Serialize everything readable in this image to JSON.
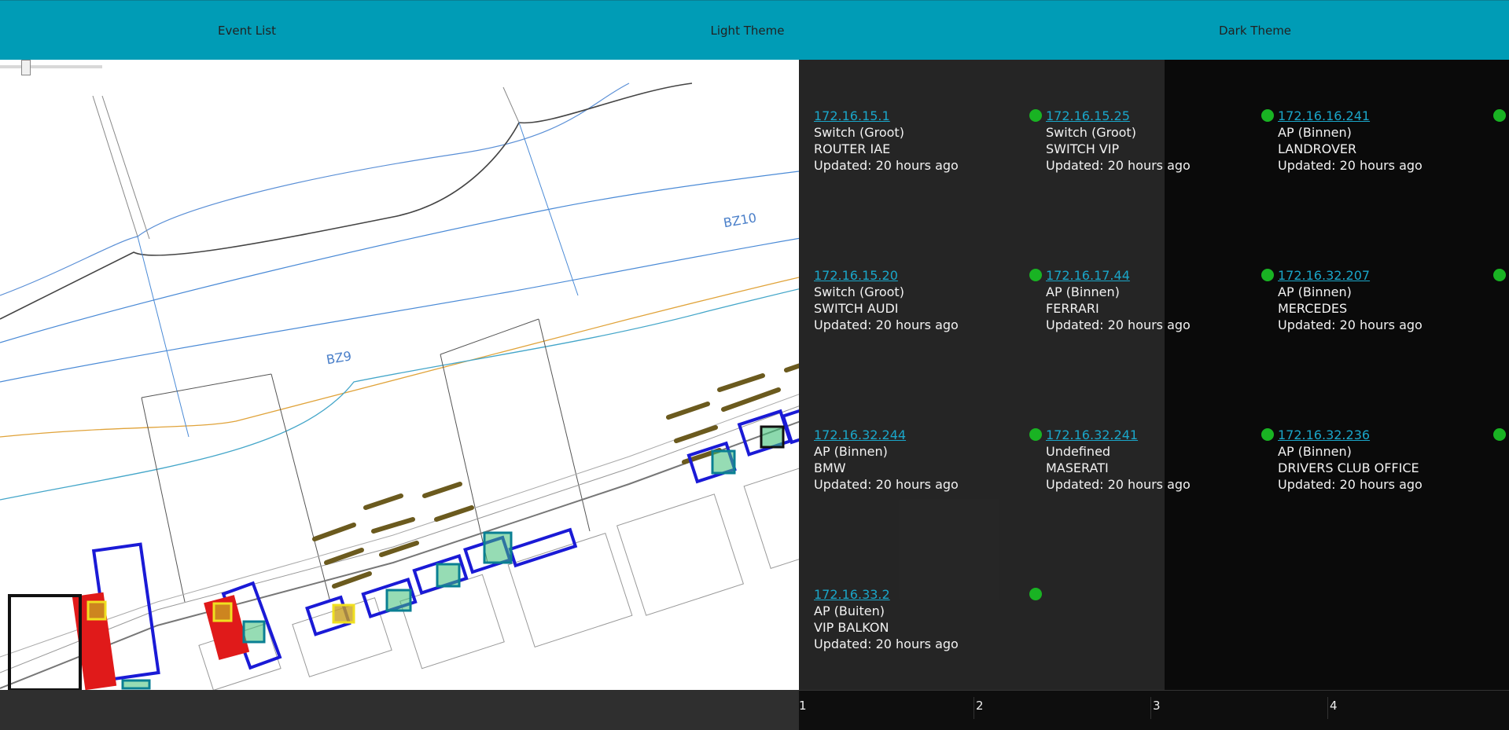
{
  "tabs": [
    {
      "label": "Event List"
    },
    {
      "label": "Light Theme"
    },
    {
      "label": "Dark Theme"
    }
  ],
  "map": {
    "labels": [
      "BZ10",
      "BZ9"
    ]
  },
  "devices": [
    {
      "ip": "172.16.15.1",
      "type": "Switch (Groot)",
      "name": "ROUTER IAE",
      "updated": "Updated: 20 hours ago",
      "status_color": "#19b323"
    },
    {
      "ip": "172.16.15.25",
      "type": "Switch (Groot)",
      "name": "SWITCH VIP",
      "updated": "Updated: 20 hours ago",
      "status_color": "#19b323"
    },
    {
      "ip": "172.16.16.241",
      "type": "AP (Binnen)",
      "name": "LANDROVER",
      "updated": "Updated: 20 hours ago",
      "status_color": "#19b323"
    },
    {
      "ip": "172.16.15.20",
      "type": "Switch (Groot)",
      "name": "SWITCH AUDI",
      "updated": "Updated: 20 hours ago",
      "status_color": "#19b323"
    },
    {
      "ip": "172.16.17.44",
      "type": "AP (Binnen)",
      "name": "FERRARI",
      "updated": "Updated: 20 hours ago",
      "status_color": "#19b323"
    },
    {
      "ip": "172.16.32.207",
      "type": "AP (Binnen)",
      "name": "MERCEDES",
      "updated": "Updated: 20 hours ago",
      "status_color": "#19b323"
    },
    {
      "ip": "172.16.32.244",
      "type": "AP (Binnen)",
      "name": "BMW",
      "updated": "Updated: 20 hours ago",
      "status_color": "#19b323"
    },
    {
      "ip": "172.16.32.241",
      "type": "Undefined",
      "name": "MASERATI",
      "updated": "Updated: 20 hours ago",
      "status_color": "#19b323"
    },
    {
      "ip": "172.16.32.236",
      "type": "AP (Binnen)",
      "name": "DRIVERS CLUB OFFICE",
      "updated": "Updated: 20 hours ago",
      "status_color": "#19b323"
    },
    {
      "ip": "172.16.33.2",
      "type": "AP (Buiten)",
      "name": "VIP BALKON",
      "updated": "Updated: 20 hours ago",
      "status_color": "#19b323"
    }
  ],
  "pagination": {
    "pages": [
      "1",
      "2",
      "3",
      "4"
    ],
    "current": "1"
  },
  "colors": {
    "header": "#009cb6",
    "link": "#1aa6c9",
    "status_ok": "#19b323"
  }
}
